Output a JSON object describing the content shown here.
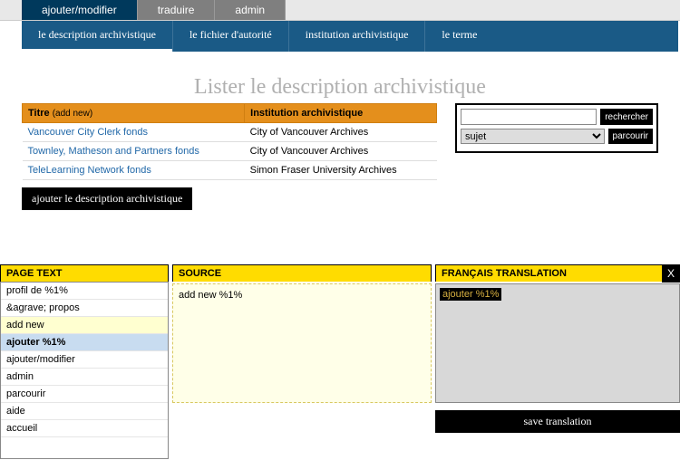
{
  "topnav": {
    "tabs": [
      "ajouter/modifier",
      "traduire",
      "admin"
    ],
    "active": 0
  },
  "secondnav": {
    "tabs": [
      "le description archivistique",
      "le fichier d'autorité",
      "institution archivistique",
      "le terme"
    ],
    "active": 0
  },
  "heading": "Lister le description archivistique",
  "table": {
    "headers": {
      "title": "Titre",
      "addnew": "(add new)",
      "inst": "Institution archivistique"
    },
    "rows": [
      {
        "title": "Vancouver City Clerk fonds",
        "inst": "City of Vancouver Archives"
      },
      {
        "title": "Townley, Matheson and Partners fonds",
        "inst": "City of Vancouver Archives"
      },
      {
        "title": "TeleLearning Network fonds",
        "inst": "Simon Fraser University Archives"
      }
    ]
  },
  "addbutton": "ajouter le description archivistique",
  "search": {
    "searchbtn": "rechercher",
    "browsebtn": "parcourir",
    "select": "sujet"
  },
  "panel": {
    "col1": "PAGE TEXT",
    "col2": "SOURCE",
    "col3": "FRANÇAIS TRANSLATION",
    "items": [
      {
        "t": "profil de %1%"
      },
      {
        "t": "&agrave; propos"
      },
      {
        "t": "add new",
        "cls": "hl-yellow"
      },
      {
        "t": "ajouter %1%",
        "cls": "hl-blue"
      },
      {
        "t": "ajouter/modifier"
      },
      {
        "t": "admin"
      },
      {
        "t": "parcourir"
      },
      {
        "t": "aide"
      },
      {
        "t": "accueil"
      }
    ],
    "source": "add new %1%",
    "translation": "ajouter %1%",
    "save": "save translation",
    "close": "X"
  }
}
